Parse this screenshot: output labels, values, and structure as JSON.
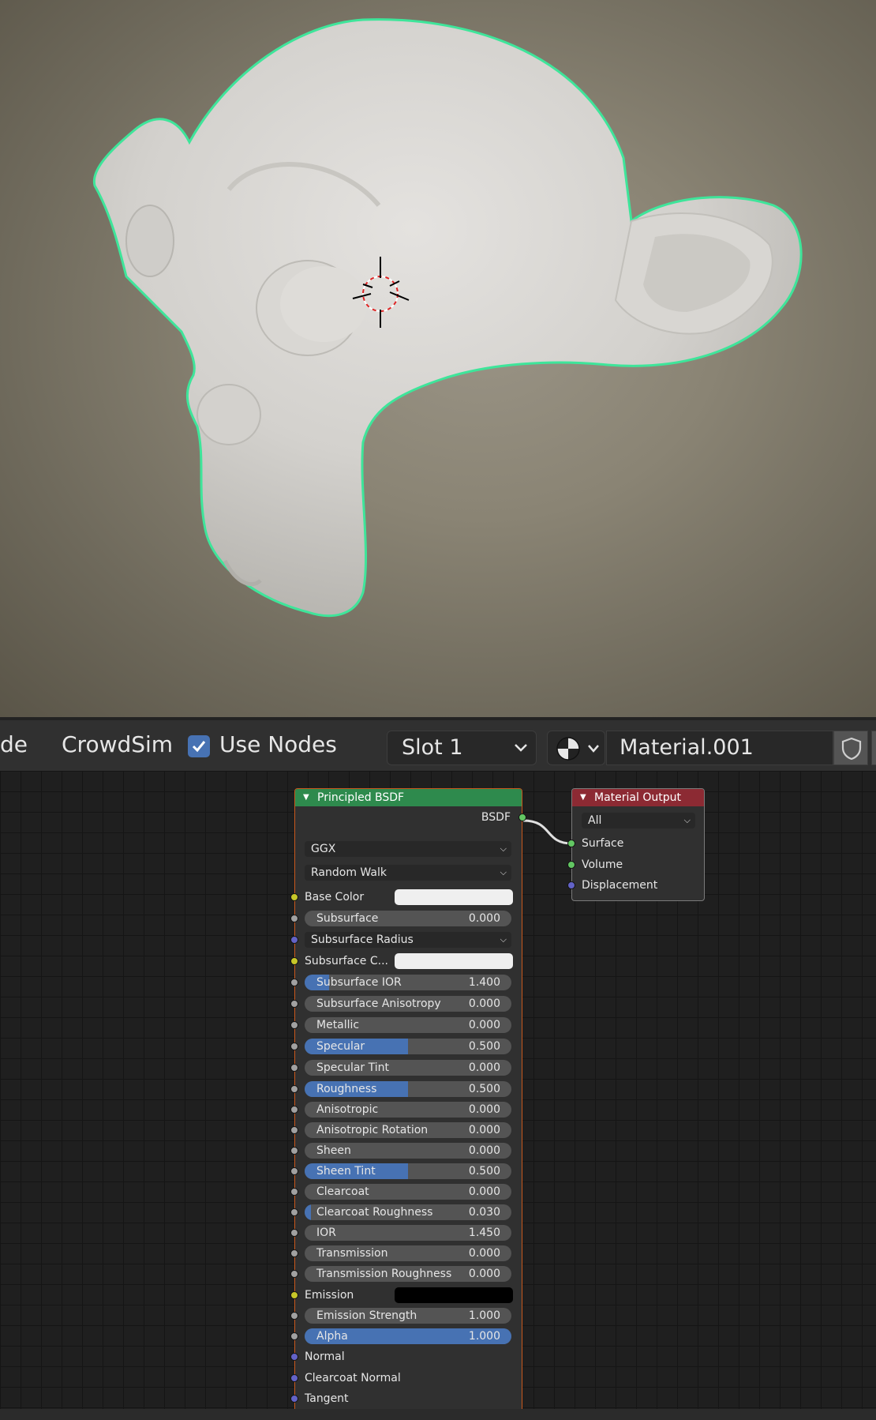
{
  "toolbar": {
    "mode_partial": "de",
    "crowdsim": "CrowdSim",
    "use_nodes_label": "Use Nodes",
    "use_nodes_checked": true,
    "slot": "Slot 1",
    "material_name": "Material.001"
  },
  "principled": {
    "title": "Principled BSDF",
    "output_label": "BSDF",
    "distribution": "GGX",
    "subsurface_method": "Random Walk",
    "base_color_label": "Base Color",
    "subsurface_color_label": "Subsurface C...",
    "subsurface_radius_label": "Subsurface Radius",
    "emission_label": "Emission",
    "sliders": [
      {
        "label": "Subsurface",
        "value": "0.000",
        "fraction": 0
      },
      {
        "label": "Subsurface IOR",
        "value": "1.400",
        "fraction": 0.12
      },
      {
        "label": "Subsurface Anisotropy",
        "value": "0.000",
        "fraction": 0
      },
      {
        "label": "Metallic",
        "value": "0.000",
        "fraction": 0
      },
      {
        "label": "Specular",
        "value": "0.500",
        "fraction": 0.5
      },
      {
        "label": "Specular Tint",
        "value": "0.000",
        "fraction": 0
      },
      {
        "label": "Roughness",
        "value": "0.500",
        "fraction": 0.5
      },
      {
        "label": "Anisotropic",
        "value": "0.000",
        "fraction": 0
      },
      {
        "label": "Anisotropic Rotation",
        "value": "0.000",
        "fraction": 0
      },
      {
        "label": "Sheen",
        "value": "0.000",
        "fraction": 0
      },
      {
        "label": "Sheen Tint",
        "value": "0.500",
        "fraction": 0.5
      },
      {
        "label": "Clearcoat",
        "value": "0.000",
        "fraction": 0
      },
      {
        "label": "Clearcoat Roughness",
        "value": "0.030",
        "fraction": 0.03
      },
      {
        "label": "IOR",
        "value": "1.450",
        "fraction": 0
      },
      {
        "label": "Transmission",
        "value": "0.000",
        "fraction": 0
      },
      {
        "label": "Transmission Roughness",
        "value": "0.000",
        "fraction": 0
      },
      {
        "label": "Emission Strength",
        "value": "1.000",
        "fraction": 0
      },
      {
        "label": "Alpha",
        "value": "1.000",
        "fraction": 1
      }
    ],
    "vector_inputs": [
      "Normal",
      "Clearcoat Normal",
      "Tangent"
    ]
  },
  "output_node": {
    "title": "Material Output",
    "target": "All",
    "inputs": [
      "Surface",
      "Volume",
      "Displacement"
    ]
  },
  "colors": {
    "principled_header": "#2e8a4d",
    "output_header": "#8c2a33",
    "selection_outline": "#3ee59a",
    "accent": "#4772b3"
  }
}
